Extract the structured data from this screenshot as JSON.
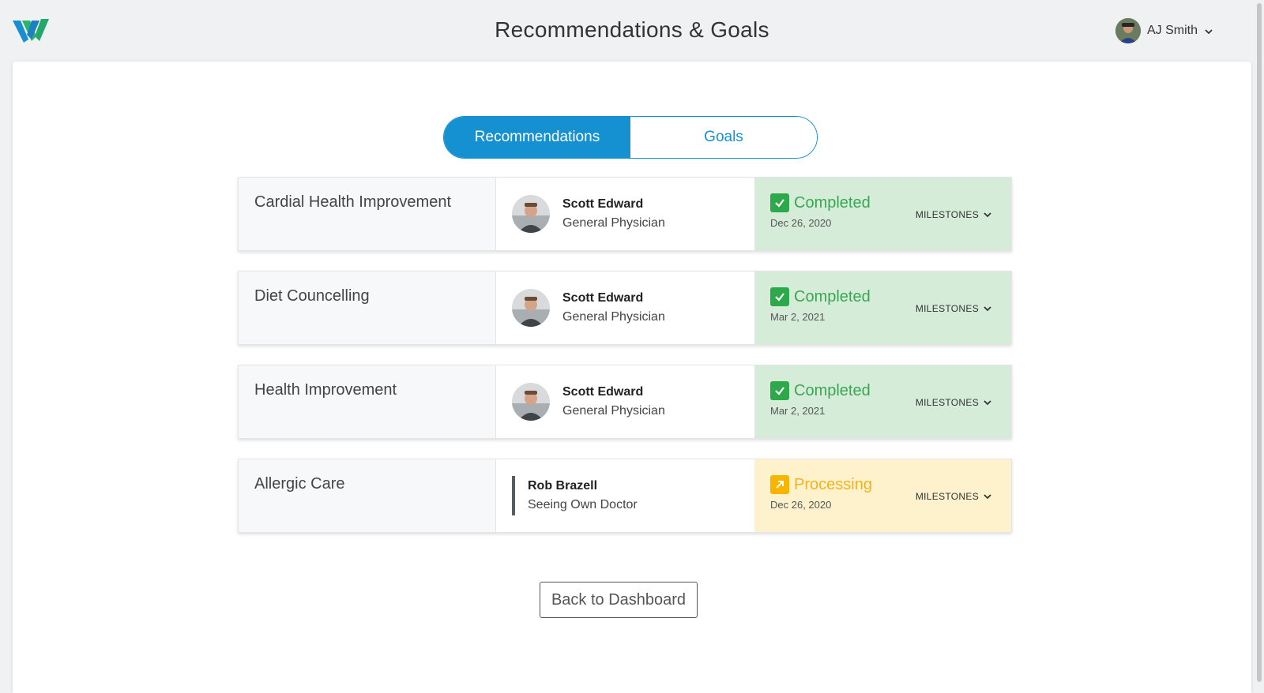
{
  "header": {
    "title": "Recommendations & Goals",
    "user_name": "AJ Smith"
  },
  "tabs": [
    {
      "label": "Recommendations",
      "active": true
    },
    {
      "label": "Goals",
      "active": false
    }
  ],
  "rows": [
    {
      "name": "Cardial Health Improvement",
      "provider_name": "Scott Edward",
      "provider_role": "General Physician",
      "status": "Completed",
      "date": "Dec 26, 2020",
      "milestones": "MILESTONES"
    },
    {
      "name": "Diet Councelling",
      "provider_name": "Scott Edward",
      "provider_role": "General Physician",
      "status": "Completed",
      "date": "Mar 2, 2021",
      "milestones": "MILESTONES"
    },
    {
      "name": "Health Improvement",
      "provider_name": "Scott Edward",
      "provider_role": "General Physician",
      "status": "Completed",
      "date": "Mar 2, 2021",
      "milestones": "MILESTONES"
    },
    {
      "name": "Allergic Care",
      "provider_name": "Rob Brazell",
      "provider_role": "Seeing Own Doctor",
      "status": "Processing",
      "date": "Dec 26, 2020",
      "milestones": "MILESTONES"
    }
  ],
  "back_button": "Back to Dashboard",
  "colors": {
    "primary": "#1590d0",
    "completed_bg": "#d5edd8",
    "completed_text": "#3aa553",
    "processing_bg": "#fdf2cc",
    "processing_text": "#f3b21e"
  },
  "icons": {
    "logo": "brand-w-logo",
    "completed": "check-icon",
    "processing": "arrow-up-right-icon",
    "dropdown": "chevron-down-icon"
  }
}
